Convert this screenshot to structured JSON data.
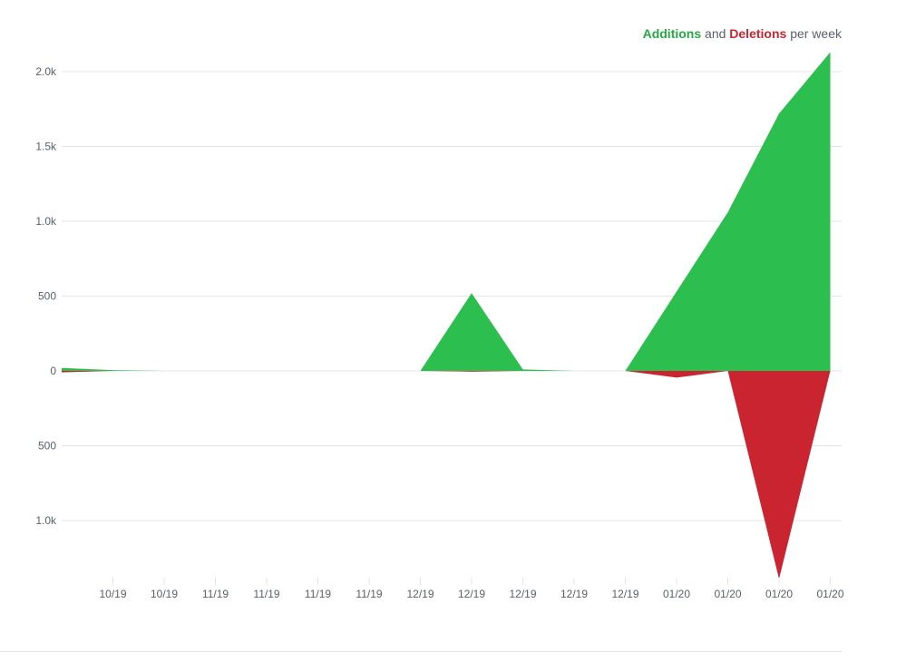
{
  "legend": {
    "additions_label": "Additions",
    "and_label": "and",
    "deletions_label": "Deletions",
    "suffix_label": "per week"
  },
  "colors": {
    "additions": "#2cbe4e",
    "deletions": "#cb2431",
    "grid": "#e1e4e8",
    "tick_text": "#586069"
  },
  "chart_data": {
    "type": "area",
    "title": "",
    "xlabel": "",
    "ylabel": "",
    "ylim": [
      -1400,
      2200
    ],
    "grid": true,
    "legend_position": "top-right",
    "y_ticks": [
      {
        "value": 2000,
        "label": "2.0k"
      },
      {
        "value": 1500,
        "label": "1.5k"
      },
      {
        "value": 1000,
        "label": "1.0k"
      },
      {
        "value": 500,
        "label": "500"
      },
      {
        "value": 0,
        "label": "0"
      },
      {
        "value": -500,
        "label": "500"
      },
      {
        "value": -1000,
        "label": "1.0k"
      }
    ],
    "x_tick_labels": [
      "10/19",
      "10/19",
      "11/19",
      "11/19",
      "11/19",
      "11/19",
      "12/19",
      "12/19",
      "12/19",
      "12/19",
      "12/19",
      "01/20",
      "01/20",
      "01/20",
      "01/20"
    ],
    "series": [
      {
        "name": "Additions",
        "values": [
          20,
          5,
          0,
          0,
          0,
          0,
          0,
          0,
          520,
          10,
          0,
          0,
          530,
          1060,
          1720,
          2130
        ]
      },
      {
        "name": "Deletions",
        "values": [
          -10,
          0,
          0,
          0,
          0,
          0,
          0,
          0,
          -5,
          0,
          0,
          0,
          -45,
          0,
          -1390,
          0
        ]
      }
    ]
  }
}
